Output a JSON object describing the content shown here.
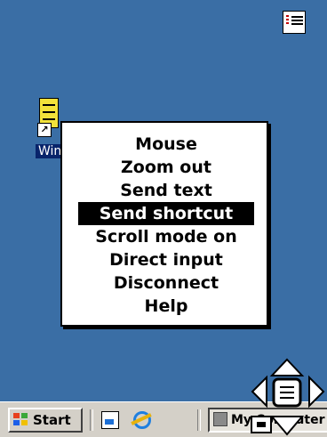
{
  "desktop": {
    "icon_label": "Win2",
    "background": "#3a6ea5"
  },
  "tray": {
    "icon": "list-icon"
  },
  "context_menu": {
    "items": [
      {
        "label": "Mouse",
        "selected": false
      },
      {
        "label": "Zoom out",
        "selected": false
      },
      {
        "label": "Send text",
        "selected": false
      },
      {
        "label": "Send shortcut",
        "selected": true
      },
      {
        "label": "Scroll mode on",
        "selected": false
      },
      {
        "label": "Direct input",
        "selected": false
      },
      {
        "label": "Disconnect",
        "selected": false
      },
      {
        "label": "Help",
        "selected": false
      }
    ]
  },
  "taskbar": {
    "start_label": "Start",
    "quick_launch": [
      "show-desktop-icon",
      "internet-explorer-icon"
    ],
    "task_label": "My Computer - You"
  },
  "nav_pad": {
    "icons": [
      "up-arrow-icon",
      "down-arrow-icon",
      "left-arrow-icon",
      "right-arrow-icon",
      "menu-icon",
      "keyboard-icon"
    ]
  }
}
